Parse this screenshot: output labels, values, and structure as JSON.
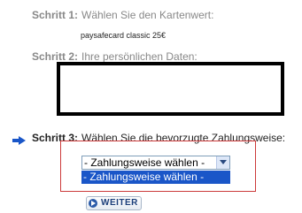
{
  "steps": [
    {
      "label": "Schritt 1:",
      "text": "Wählen Sie den Kartenwert:"
    },
    {
      "label": "Schritt 2:",
      "text": "Ihre persönlichen Daten:"
    },
    {
      "label": "Schritt 3:",
      "text": "Wählen Sie die bevorzugte Zahlungsweise:"
    }
  ],
  "product": "paysafecard classic 25€",
  "payment": {
    "selected": "- Zahlungsweise wählen -",
    "options": [
      "- Zahlungsweise wählen -"
    ]
  },
  "button": {
    "label": "WEITER"
  },
  "colors": {
    "accent": "#1a56c8",
    "border": "#cc3a3a",
    "inactive": "#888888"
  },
  "icons": {
    "current_step": "right-arrow-icon",
    "button": "play-circle-icon",
    "dropdown": "chevron-down-icon"
  }
}
